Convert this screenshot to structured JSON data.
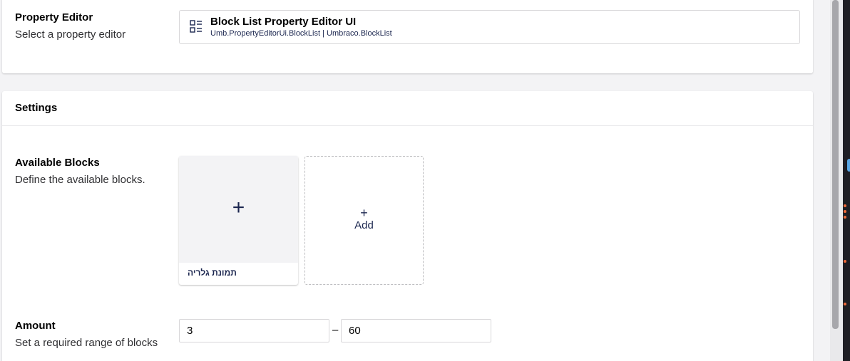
{
  "property_editor": {
    "title": "Property Editor",
    "description": "Select a property editor",
    "selected": {
      "icon": "block-list-icon",
      "name": "Block List Property Editor UI",
      "alias": "Umb.PropertyEditorUi.BlockList | Umbraco.BlockList"
    }
  },
  "settings": {
    "title": "Settings",
    "available_blocks": {
      "title": "Available Blocks",
      "description": "Define the available blocks.",
      "blocks": [
        {
          "name": "תמונת גלריה",
          "icon": "plus-icon"
        }
      ],
      "add_symbol": "+",
      "add_label": "Add"
    },
    "amount": {
      "title": "Amount",
      "description": "Set a required range of blocks",
      "min": "3",
      "max": "60",
      "separator": "–"
    }
  },
  "colors": {
    "primary_text": "#1b264f",
    "surface": "#ffffff",
    "background": "#f3f3f5",
    "border": "#d8d7d9"
  }
}
